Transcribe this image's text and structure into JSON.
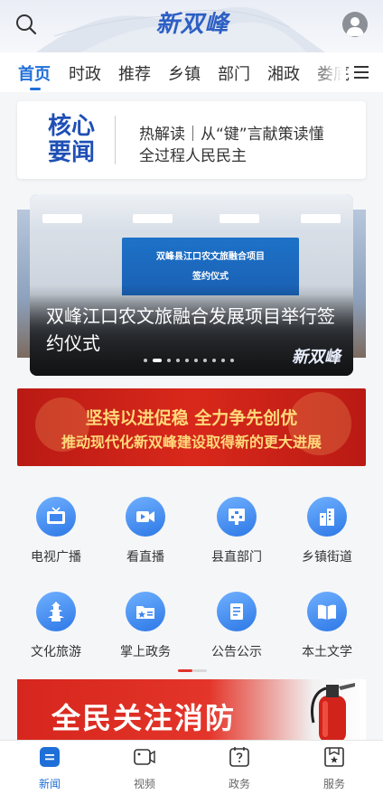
{
  "header": {
    "logo_text": "新双峰",
    "search_icon": "search-icon",
    "user_icon": "user-icon"
  },
  "tabs": {
    "items": [
      {
        "label": "首页",
        "active": true
      },
      {
        "label": "时政",
        "active": false
      },
      {
        "label": "推荐",
        "active": false
      },
      {
        "label": "乡镇",
        "active": false
      },
      {
        "label": "部门",
        "active": false
      },
      {
        "label": "湘政",
        "active": false
      },
      {
        "label": "娄底",
        "active": false
      }
    ],
    "menu_icon": "menu-icon"
  },
  "core_news": {
    "title_line1": "核心",
    "title_line2": "要闻",
    "line1": "热解读｜从“键”言献策读懂",
    "line2": "全过程人民民主"
  },
  "carousel": {
    "caption": "双峰江口农文旅融合发展项目举行签约仪式",
    "screen_line1": "双峰县江口农文旅融合项目",
    "screen_line2": "签约仪式",
    "watermark": "新双峰",
    "dot_count": 10,
    "active_dot": 1
  },
  "banner": {
    "line1": "坚持以进促稳 全力争先创优",
    "line2": "推动现代化新双峰建设取得新的更大进展"
  },
  "grid": {
    "items": [
      {
        "label": "电视广播",
        "icon": "tv-icon"
      },
      {
        "label": "看直播",
        "icon": "live-video-icon"
      },
      {
        "label": "县直部门",
        "icon": "department-icon"
      },
      {
        "label": "乡镇街道",
        "icon": "buildings-icon"
      },
      {
        "label": "文化旅游",
        "icon": "pagoda-icon"
      },
      {
        "label": "掌上政务",
        "icon": "government-folder-icon"
      },
      {
        "label": "公告公示",
        "icon": "notice-icon"
      },
      {
        "label": "本土文学",
        "icon": "book-icon"
      }
    ]
  },
  "fire_banner": {
    "text": "全民关注消防",
    "icon": "fire-extinguisher-icon"
  },
  "bottom_nav": {
    "items": [
      {
        "label": "新闻",
        "icon": "news-icon",
        "active": true
      },
      {
        "label": "视频",
        "icon": "video-icon",
        "active": false
      },
      {
        "label": "政务",
        "icon": "government-icon",
        "active": false
      },
      {
        "label": "服务",
        "icon": "service-icon",
        "active": false
      }
    ]
  },
  "colors": {
    "accent": "#1f6fd8",
    "core_title": "#1e4fb5",
    "banner_red": "#c81f17",
    "banner_text": "#ffd97a"
  }
}
